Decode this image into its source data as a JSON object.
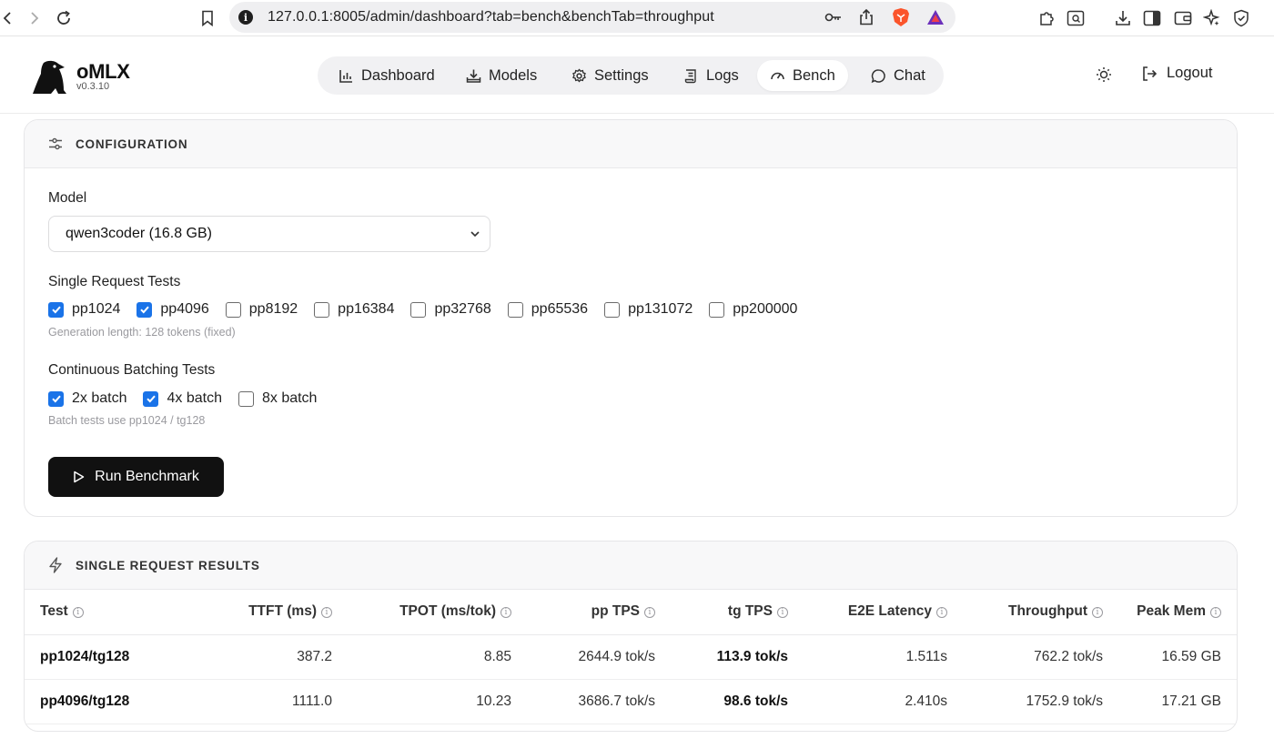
{
  "browser": {
    "url": "127.0.0.1:8005/admin/dashboard?tab=bench&benchTab=throughput"
  },
  "brand": {
    "name": "oMLX",
    "version": "v0.3.10"
  },
  "nav": {
    "items": [
      {
        "label": "Dashboard",
        "icon": "bar-chart-icon"
      },
      {
        "label": "Models",
        "icon": "download-icon"
      },
      {
        "label": "Settings",
        "icon": "gear-icon"
      },
      {
        "label": "Logs",
        "icon": "scroll-icon"
      },
      {
        "label": "Bench",
        "icon": "gauge-icon",
        "active": true
      },
      {
        "label": "Chat",
        "icon": "chat-bubble-icon"
      }
    ],
    "logout_label": "Logout"
  },
  "config": {
    "title": "CONFIGURATION",
    "model_label": "Model",
    "model_selected": "qwen3coder (16.8 GB)",
    "single_label": "Single Request Tests",
    "single_tests": [
      {
        "label": "pp1024",
        "checked": true
      },
      {
        "label": "pp4096",
        "checked": true
      },
      {
        "label": "pp8192",
        "checked": false
      },
      {
        "label": "pp16384",
        "checked": false
      },
      {
        "label": "pp32768",
        "checked": false
      },
      {
        "label": "pp65536",
        "checked": false
      },
      {
        "label": "pp131072",
        "checked": false
      },
      {
        "label": "pp200000",
        "checked": false
      }
    ],
    "single_hint": "Generation length: 128 tokens (fixed)",
    "batch_label": "Continuous Batching Tests",
    "batch_tests": [
      {
        "label": "2x batch",
        "checked": true
      },
      {
        "label": "4x batch",
        "checked": true
      },
      {
        "label": "8x batch",
        "checked": false
      }
    ],
    "batch_hint": "Batch tests use pp1024 / tg128",
    "run_label": "Run Benchmark"
  },
  "results": {
    "title": "SINGLE REQUEST RESULTS",
    "columns": [
      "Test",
      "TTFT (ms)",
      "TPOT (ms/tok)",
      "pp TPS",
      "tg TPS",
      "E2E Latency",
      "Throughput",
      "Peak Mem"
    ],
    "rows": [
      [
        "pp1024/tg128",
        "387.2",
        "8.85",
        "2644.9 tok/s",
        "113.9 tok/s",
        "1.511s",
        "762.2 tok/s",
        "16.59 GB"
      ],
      [
        "pp4096/tg128",
        "1111.0",
        "10.23",
        "3686.7 tok/s",
        "98.6 tok/s",
        "2.410s",
        "1752.9 tok/s",
        "17.21 GB"
      ]
    ]
  },
  "colors": {
    "accent": "#1a73e8",
    "primary_button": "#111111",
    "brave": "#fb542b"
  }
}
